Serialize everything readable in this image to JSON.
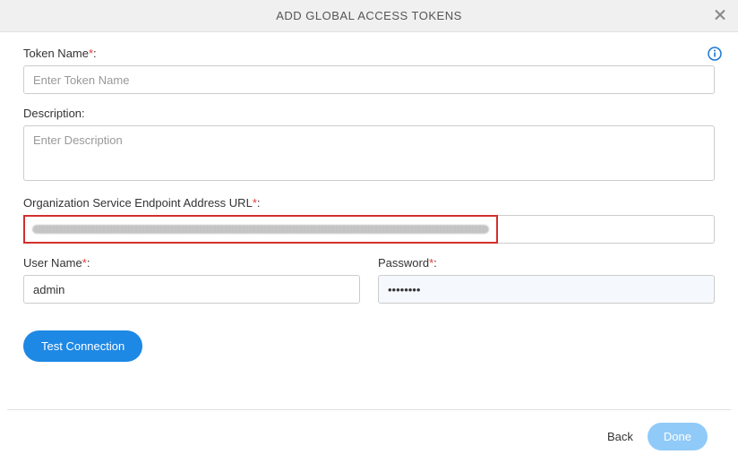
{
  "header": {
    "title": "ADD GLOBAL ACCESS TOKENS"
  },
  "fields": {
    "tokenName": {
      "label": "Token Name",
      "placeholder": "Enter Token Name",
      "value": ""
    },
    "description": {
      "label": "Description:",
      "placeholder": "Enter Description",
      "value": ""
    },
    "endpoint": {
      "label": "Organization Service Endpoint Address URL"
    },
    "userName": {
      "label": "User Name",
      "value": "admin"
    },
    "password": {
      "label": "Password",
      "value": "••••••••"
    }
  },
  "buttons": {
    "testConnection": "Test Connection",
    "back": "Back",
    "done": "Done"
  }
}
